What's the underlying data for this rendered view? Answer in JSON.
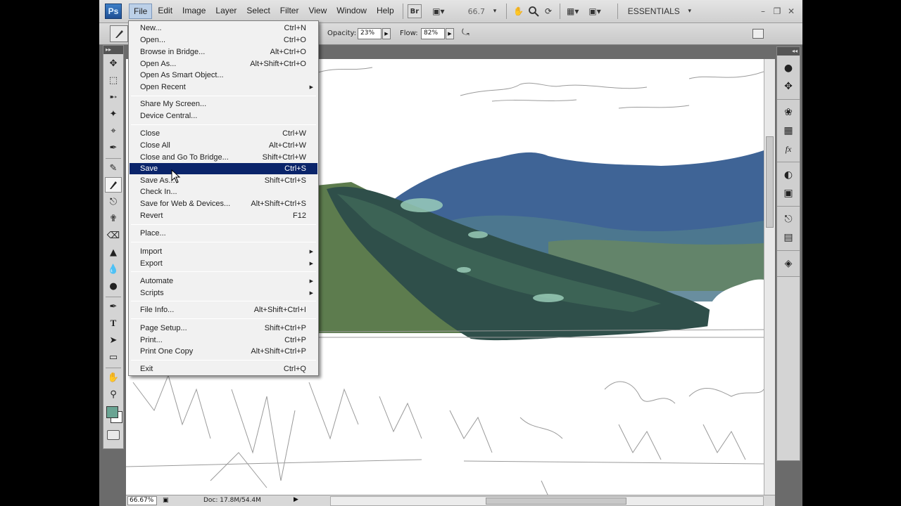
{
  "app": {
    "logo": "Ps",
    "workspace": "ESSENTIALS",
    "zoom_readout": "66.7"
  },
  "menubar": [
    "File",
    "Edit",
    "Image",
    "Layer",
    "Select",
    "Filter",
    "View",
    "Window",
    "Help"
  ],
  "toolbar": {
    "bridge_label": "Br"
  },
  "options": {
    "opacity_label": "Opacity:",
    "opacity_value": "23%",
    "flow_label": "Flow:",
    "flow_value": "82%"
  },
  "file_menu": {
    "items": [
      {
        "label": "New...",
        "shortcut": "Ctrl+N"
      },
      {
        "label": "Open...",
        "shortcut": "Ctrl+O"
      },
      {
        "label": "Browse in Bridge...",
        "shortcut": "Alt+Ctrl+O"
      },
      {
        "label": "Open As...",
        "shortcut": "Alt+Shift+Ctrl+O"
      },
      {
        "label": "Open As Smart Object...",
        "shortcut": ""
      },
      {
        "label": "Open Recent",
        "shortcut": "",
        "submenu": true
      },
      {
        "label": "Share My Screen...",
        "shortcut": ""
      },
      {
        "label": "Device Central...",
        "shortcut": ""
      },
      {
        "label": "Close",
        "shortcut": "Ctrl+W"
      },
      {
        "label": "Close All",
        "shortcut": "Alt+Ctrl+W"
      },
      {
        "label": "Close and Go To Bridge...",
        "shortcut": "Shift+Ctrl+W"
      },
      {
        "label": "Save",
        "shortcut": "Ctrl+S",
        "highlighted": true
      },
      {
        "label": "Save As...",
        "shortcut": "Shift+Ctrl+S"
      },
      {
        "label": "Check In...",
        "shortcut": ""
      },
      {
        "label": "Save for Web & Devices...",
        "shortcut": "Alt+Shift+Ctrl+S"
      },
      {
        "label": "Revert",
        "shortcut": "F12"
      },
      {
        "label": "Place...",
        "shortcut": ""
      },
      {
        "label": "Import",
        "shortcut": "",
        "submenu": true
      },
      {
        "label": "Export",
        "shortcut": "",
        "submenu": true
      },
      {
        "label": "Automate",
        "shortcut": "",
        "submenu": true
      },
      {
        "label": "Scripts",
        "shortcut": "",
        "submenu": true
      },
      {
        "label": "File Info...",
        "shortcut": "Alt+Shift+Ctrl+I"
      },
      {
        "label": "Page Setup...",
        "shortcut": "Shift+Ctrl+P"
      },
      {
        "label": "Print...",
        "shortcut": "Ctrl+P"
      },
      {
        "label": "Print One Copy",
        "shortcut": "Alt+Shift+Ctrl+P"
      },
      {
        "label": "Exit",
        "shortcut": "Ctrl+Q"
      }
    ]
  },
  "status": {
    "zoom": "66.67%",
    "doc": "Doc: 17.8M/54.4M"
  },
  "colors": {
    "foreground": "#6aa493",
    "background": "#ffffff",
    "menu_highlight": "#0a246a"
  }
}
